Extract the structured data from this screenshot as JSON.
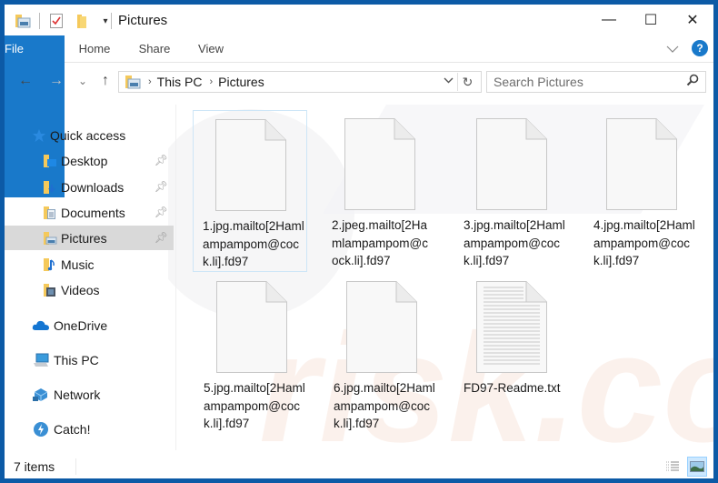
{
  "window": {
    "title": "Pictures",
    "controls": {
      "minimize": "—",
      "maximize": "☐",
      "close": "✕"
    }
  },
  "ribbon": {
    "tabs": [
      {
        "label": "File",
        "active": true
      },
      {
        "label": "Home"
      },
      {
        "label": "Share"
      },
      {
        "label": "View"
      }
    ],
    "help": "?"
  },
  "navigation": {
    "back": "←",
    "forward": "→",
    "recent": "⌄",
    "up": "↑",
    "breadcrumb": [
      "This PC",
      "Pictures"
    ],
    "search_placeholder": "Search Pictures"
  },
  "sidebar": {
    "items": [
      {
        "label": "Quick access",
        "icon": "star-icon"
      },
      {
        "label": "Desktop",
        "icon": "desktop-folder-icon",
        "pinned": true
      },
      {
        "label": "Downloads",
        "icon": "downloads-folder-icon",
        "pinned": true
      },
      {
        "label": "Documents",
        "icon": "documents-folder-icon",
        "pinned": true
      },
      {
        "label": "Pictures",
        "icon": "pictures-folder-icon",
        "pinned": true,
        "selected": true
      },
      {
        "label": "Music",
        "icon": "music-folder-icon"
      },
      {
        "label": "Videos",
        "icon": "videos-folder-icon"
      },
      {
        "label": "OneDrive",
        "icon": "onedrive-icon"
      },
      {
        "label": "This PC",
        "icon": "computer-icon"
      },
      {
        "label": "Network",
        "icon": "network-icon"
      },
      {
        "label": "Catch!",
        "icon": "catch-icon"
      }
    ]
  },
  "files": [
    {
      "name": "1.jpg.mailto[2Hamlampampom@cock.li].fd97",
      "type": "blank",
      "selected": true
    },
    {
      "name": "2.jpeg.mailto[2Hamlampampom@cock.li].fd97",
      "type": "blank"
    },
    {
      "name": "3.jpg.mailto[2Hamlampampom@cock.li].fd97",
      "type": "blank"
    },
    {
      "name": "4.jpg.mailto[2Hamlampampom@cock.li].fd97",
      "type": "blank"
    },
    {
      "name": "5.jpg.mailto[2Hamlampampom@cock.li].fd97",
      "type": "blank"
    },
    {
      "name": "6.jpg.mailto[2Hamlampampom@cock.li].fd97",
      "type": "blank"
    },
    {
      "name": "FD97-Readme.txt",
      "type": "text"
    }
  ],
  "status": {
    "item_count": "7 items"
  },
  "colors": {
    "accent": "#1979ca",
    "frame": "#0c5aa6",
    "selected_nav": "#d9d9d9"
  }
}
